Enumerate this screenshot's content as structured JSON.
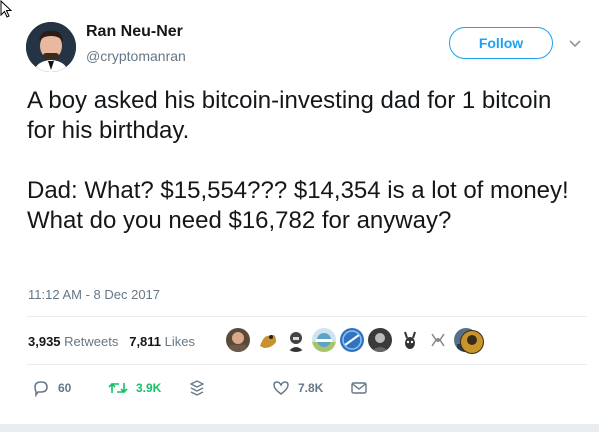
{
  "author": {
    "name": "Ran Neu-Ner",
    "handle": "@cryptomanran"
  },
  "follow_button": {
    "label": "Follow"
  },
  "tweet": {
    "paragraphs": [
      "A boy asked his bitcoin-investing dad for 1 bitcoin for his birthday.",
      "Dad: What? $15,554??? $14,354 is a lot of money! What do you need $16,782 for anyway?"
    ],
    "timestamp": "11:12 AM - 8 Dec 2017"
  },
  "stats": {
    "retweets_count": "3,935",
    "retweets_label": "Retweets",
    "likes_count": "7,811",
    "likes_label": "Likes"
  },
  "actions": {
    "reply_count": "60",
    "retweet_count": "3.9K",
    "like_count": "7.8K"
  },
  "colors": {
    "accent": "#1da1f2",
    "retweet_green": "#17bf63",
    "muted": "#657786",
    "text": "#14171a"
  },
  "icons": [
    "cursor-icon",
    "chevron-down-icon",
    "reply-icon",
    "retweet-icon",
    "stack-icon",
    "heart-icon",
    "message-icon"
  ]
}
